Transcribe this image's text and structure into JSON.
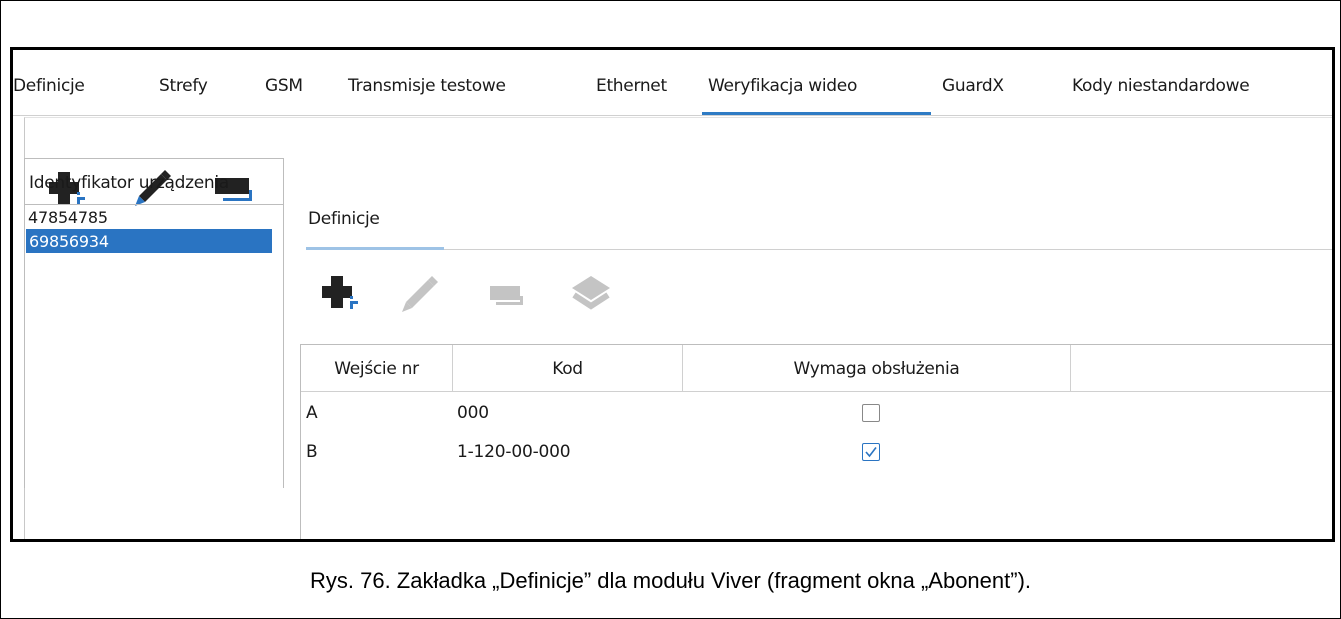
{
  "main_tabs": [
    {
      "label": "Definicje"
    },
    {
      "label": "Strefy"
    },
    {
      "label": "GSM"
    },
    {
      "label": "Transmisje testowe"
    },
    {
      "label": "Ethernet"
    },
    {
      "label": "Weryfikacja wideo"
    },
    {
      "label": "GuardX"
    },
    {
      "label": "Kody niestandardowe"
    }
  ],
  "active_main_tab": "Weryfikacja wideo",
  "device_list": {
    "header": "Identyfikator urządzenia",
    "items": [
      "47854785",
      "69856934"
    ],
    "selected": "69856934"
  },
  "sub_tab": {
    "label": "Definicje"
  },
  "table": {
    "columns": [
      "Wejście nr",
      "Kod",
      "Wymaga obsłużenia"
    ],
    "rows": [
      {
        "input": "A",
        "code": "000",
        "required": false
      },
      {
        "input": "B",
        "code": "1-120-00-000",
        "required": true
      }
    ]
  },
  "icons": {
    "left_toolbar": [
      "add-icon",
      "edit-icon",
      "remove-icon"
    ],
    "table_toolbar": [
      "add-icon",
      "edit-icon",
      "remove-icon",
      "layers-icon"
    ]
  },
  "colors": {
    "accent": "#2a74c2",
    "selection": "#2a74c2"
  },
  "caption": "Rys. 76. Zakładka „Definicje” dla modułu Viver (fragment okna „Abonent”)."
}
